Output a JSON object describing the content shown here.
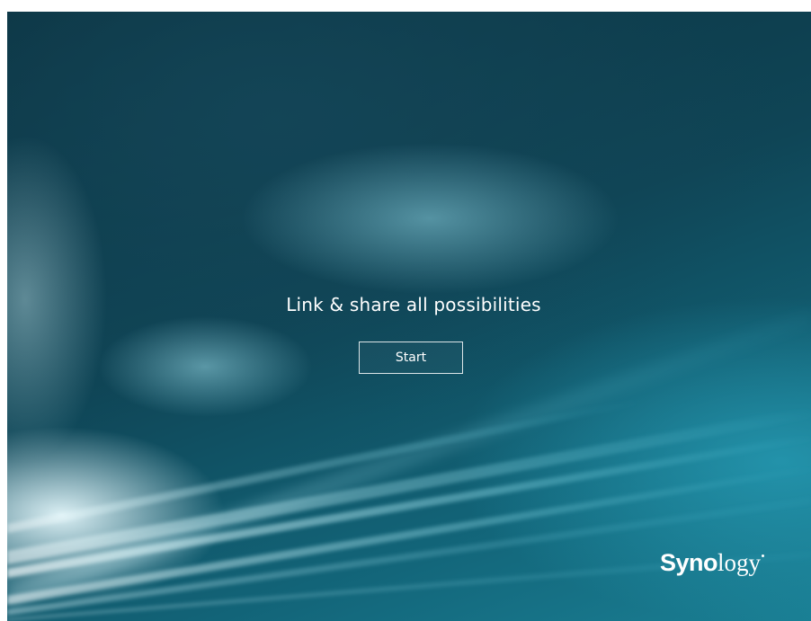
{
  "welcome": {
    "tagline": "Link & share all possibilities",
    "start_label": "Start"
  },
  "brand": {
    "name_bold": "Syno",
    "name_light": "logy"
  },
  "colors": {
    "background_dark": "#0d3d4c",
    "background_teal": "#1a7f94",
    "text": "#ffffff"
  }
}
